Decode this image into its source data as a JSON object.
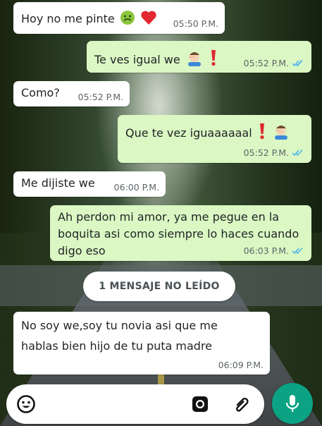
{
  "messages": [
    {
      "direction": "incoming",
      "text": "Hoy no me pinte",
      "emoji": [
        "nauseated-face",
        "red-heart"
      ],
      "time": "05:50 P.M."
    },
    {
      "direction": "outgoing",
      "text": "Te ves igual we",
      "emoji": [
        "man-facepalming",
        "heavy-exclamation-mark"
      ],
      "time": "05:52 P.M.",
      "status": "read"
    },
    {
      "direction": "incoming",
      "text": "Como?",
      "time": "05:52 P.M."
    },
    {
      "direction": "outgoing",
      "text": "Que te vez iguaaaaaal",
      "emoji": [
        "heavy-exclamation-mark",
        "man-facepalming"
      ],
      "time": "05:52 P.M.",
      "status": "read"
    },
    {
      "direction": "incoming",
      "text": "Me dijiste we",
      "time": "06:00 P.M."
    },
    {
      "direction": "outgoing",
      "text": "Ah perdon mi amor, ya me pegue en la boquita asi como siempre lo haces cuando digo eso",
      "time": "06:03 P.M.",
      "status": "read"
    },
    {
      "direction": "incoming",
      "text": "No soy we,soy tu novia asi que me hablas bien hijo de tu puta madre",
      "time": "06:09 P.M."
    }
  ],
  "unread_banner": "1 MENSAJE NO LEÍDO",
  "composer": {
    "placeholder": "",
    "icons": [
      "emoji-icon",
      "camera-icon",
      "attach-icon"
    ]
  },
  "mic_icon": "microphone-icon",
  "colors": {
    "incoming_bubble": "#ffffff",
    "outgoing_bubble": "#dbf7c3",
    "read_ticks": "#4fb6ec",
    "mic_button": "#0ba383"
  }
}
